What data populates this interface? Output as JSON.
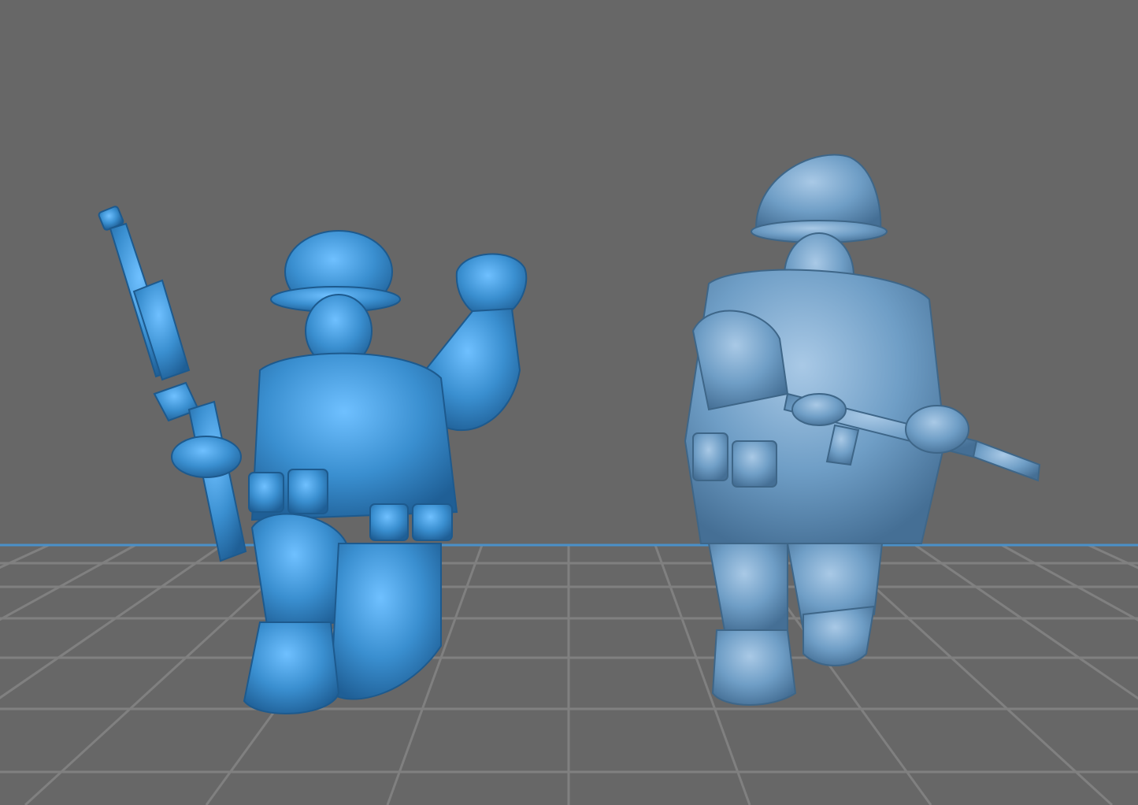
{
  "viewport": {
    "background_color": "#676767",
    "grid_line_color": "#808080",
    "horizon_line_color": "#4a90c8"
  },
  "models": [
    {
      "name": "kneeling-soldier-with-rifle",
      "selected": true,
      "color": "#3a8fd0"
    },
    {
      "name": "advancing-soldier-with-smg",
      "selected": false,
      "color": "#6f9ec6"
    }
  ]
}
